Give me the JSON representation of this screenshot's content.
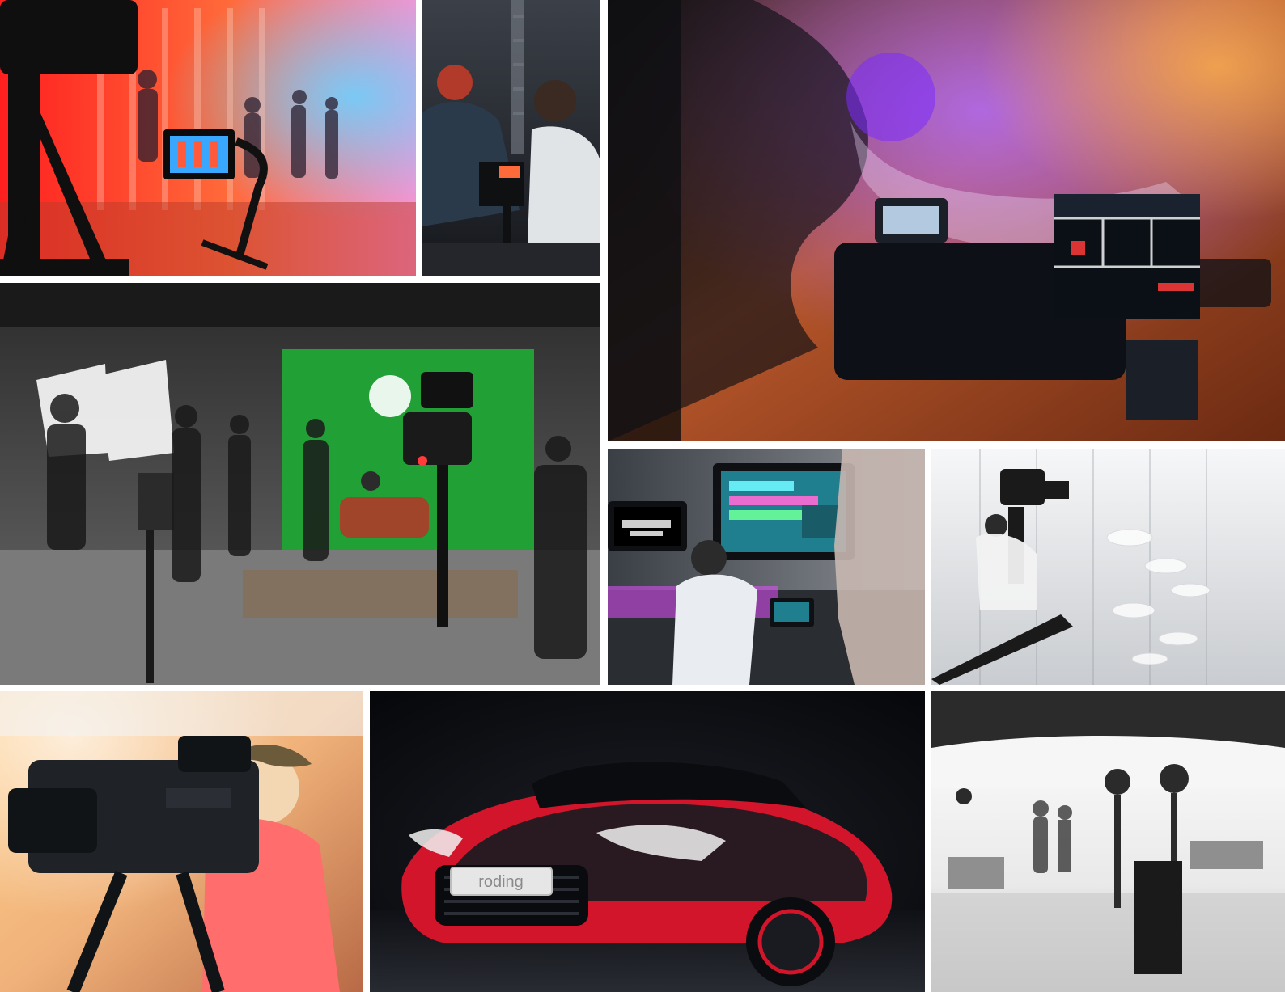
{
  "collage": {
    "background": "#ffffff",
    "photos": [
      {
        "name": "concert-camera-monitor",
        "palette": [
          "#ff3a2e",
          "#ff8a3c",
          "#6bd1ff",
          "#1a1a1a"
        ]
      },
      {
        "name": "gimbal-rig-crew",
        "palette": [
          "#2a2f36",
          "#111318",
          "#c7c9cc",
          "#ff6a3a"
        ]
      },
      {
        "name": "clapperboard-set",
        "palette": [
          "#e85a1f",
          "#ffb24a",
          "#b16cff",
          "#0d1016"
        ]
      },
      {
        "name": "greenscreen-studio",
        "palette": [
          "#21a036",
          "#1a1a1a",
          "#6b6b6b",
          "#c8ced6"
        ]
      },
      {
        "name": "audio-editing-room",
        "palette": [
          "#e451ff",
          "#5a5a5a",
          "#1f7f8e",
          "#0f1217"
        ]
      },
      {
        "name": "camera-crane",
        "palette": [
          "#f2f4f6",
          "#c9ccd0",
          "#1a1a1a",
          "#9aa0a6"
        ]
      },
      {
        "name": "camera-operator",
        "palette": [
          "#ff6d6d",
          "#ffb85a",
          "#2a2a2a",
          "#f3d6b2"
        ]
      },
      {
        "name": "red-black-roadster",
        "palette": [
          "#0a0b0f",
          "#d2152b",
          "#1d1f26",
          "#f2f2f2"
        ],
        "plate_text": "roding"
      },
      {
        "name": "white-cyclorama-studio",
        "palette": [
          "#f6f6f6",
          "#d6d6d6",
          "#2b2b2b",
          "#8f8f8f"
        ]
      }
    ]
  }
}
